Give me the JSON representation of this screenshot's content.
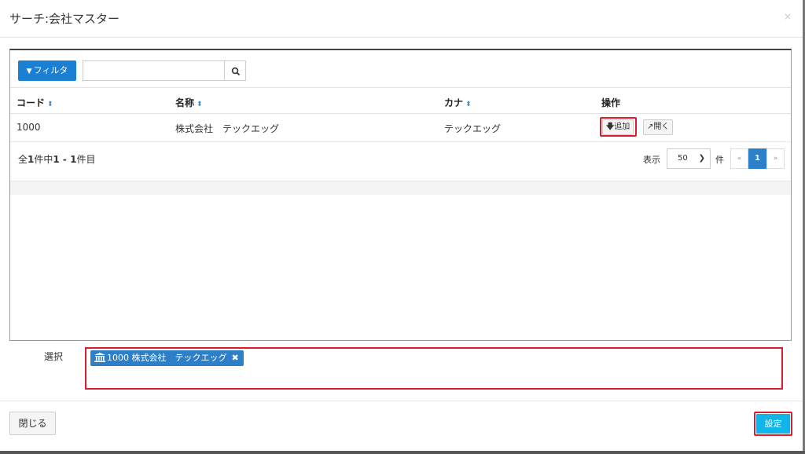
{
  "dialog": {
    "title": "サーチ:会社マスター",
    "close_symbol": "×"
  },
  "toolbar": {
    "filter_label": "フィルタ",
    "search_value": "",
    "search_placeholder": ""
  },
  "table": {
    "headers": [
      {
        "label": "コード",
        "sortable": true
      },
      {
        "label": "名称",
        "sortable": true
      },
      {
        "label": "カナ",
        "sortable": true
      },
      {
        "label": "操作",
        "sortable": false
      }
    ],
    "sort_glyph": "⬍",
    "rows": [
      {
        "code": "1000",
        "name": "株式会社　テックエッグ",
        "kana": "テックエッグ",
        "add_label": "追加",
        "open_label": "開く"
      }
    ]
  },
  "summary": {
    "prefix": "全",
    "total": "1",
    "mid": "件中",
    "from": "1",
    "dash": " - ",
    "to": "1",
    "suffix": "件目"
  },
  "pager": {
    "display_label": "表示",
    "page_size": "50",
    "unit_label": "件",
    "prev": "«",
    "current": "1",
    "next": "»"
  },
  "selection": {
    "label": "選択",
    "tags": [
      {
        "text": "1000 株式会社　テックエッグ"
      }
    ]
  },
  "footer": {
    "close_label": "閉じる",
    "set_label": "設定"
  },
  "icons": {
    "filter": "filter-icon",
    "search": "search-icon",
    "add": "arrow-down-icon",
    "open": "external-link-icon",
    "tag": "bank-icon",
    "remove": "times-icon"
  },
  "colors": {
    "primary": "#1b7fd2",
    "tag": "#2d7fc8",
    "set_button": "#10b4e8",
    "highlight": "#d81e2a"
  }
}
